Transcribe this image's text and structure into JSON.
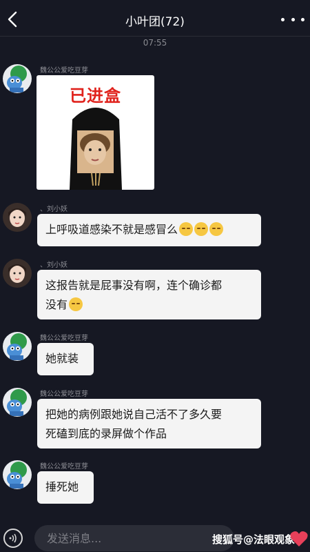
{
  "header": {
    "title": "小叶团(72)"
  },
  "timestamp": "07:55",
  "sticker": {
    "text": "已进盒"
  },
  "messages": [
    {
      "sender": "魏公公爱吃豆芽",
      "type": "image"
    },
    {
      "sender": "、刘小妖",
      "text": "上呼吸道感染不就是感冒么",
      "emoji_count": 3
    },
    {
      "sender": "、刘小妖",
      "line1": "这报告就是屁事没有啊，连个确诊都",
      "line2": "没有",
      "emoji_count": 1
    },
    {
      "sender": "魏公公爱吃豆芽",
      "text": "她就装"
    },
    {
      "sender": "魏公公爱吃豆芽",
      "line1": "把她的病例跟她说自己活不了多久要",
      "line2": "死磕到底的录屏做个作品"
    },
    {
      "sender": "魏公公爱吃豆芽",
      "text": "捶死她"
    }
  ],
  "input": {
    "placeholder": "发送消息..."
  },
  "watermark": "搜狐号@法眼观象",
  "colors": {
    "background": "#161823",
    "bubble": "#f4f4f4",
    "sticker_red": "#e0221c"
  }
}
